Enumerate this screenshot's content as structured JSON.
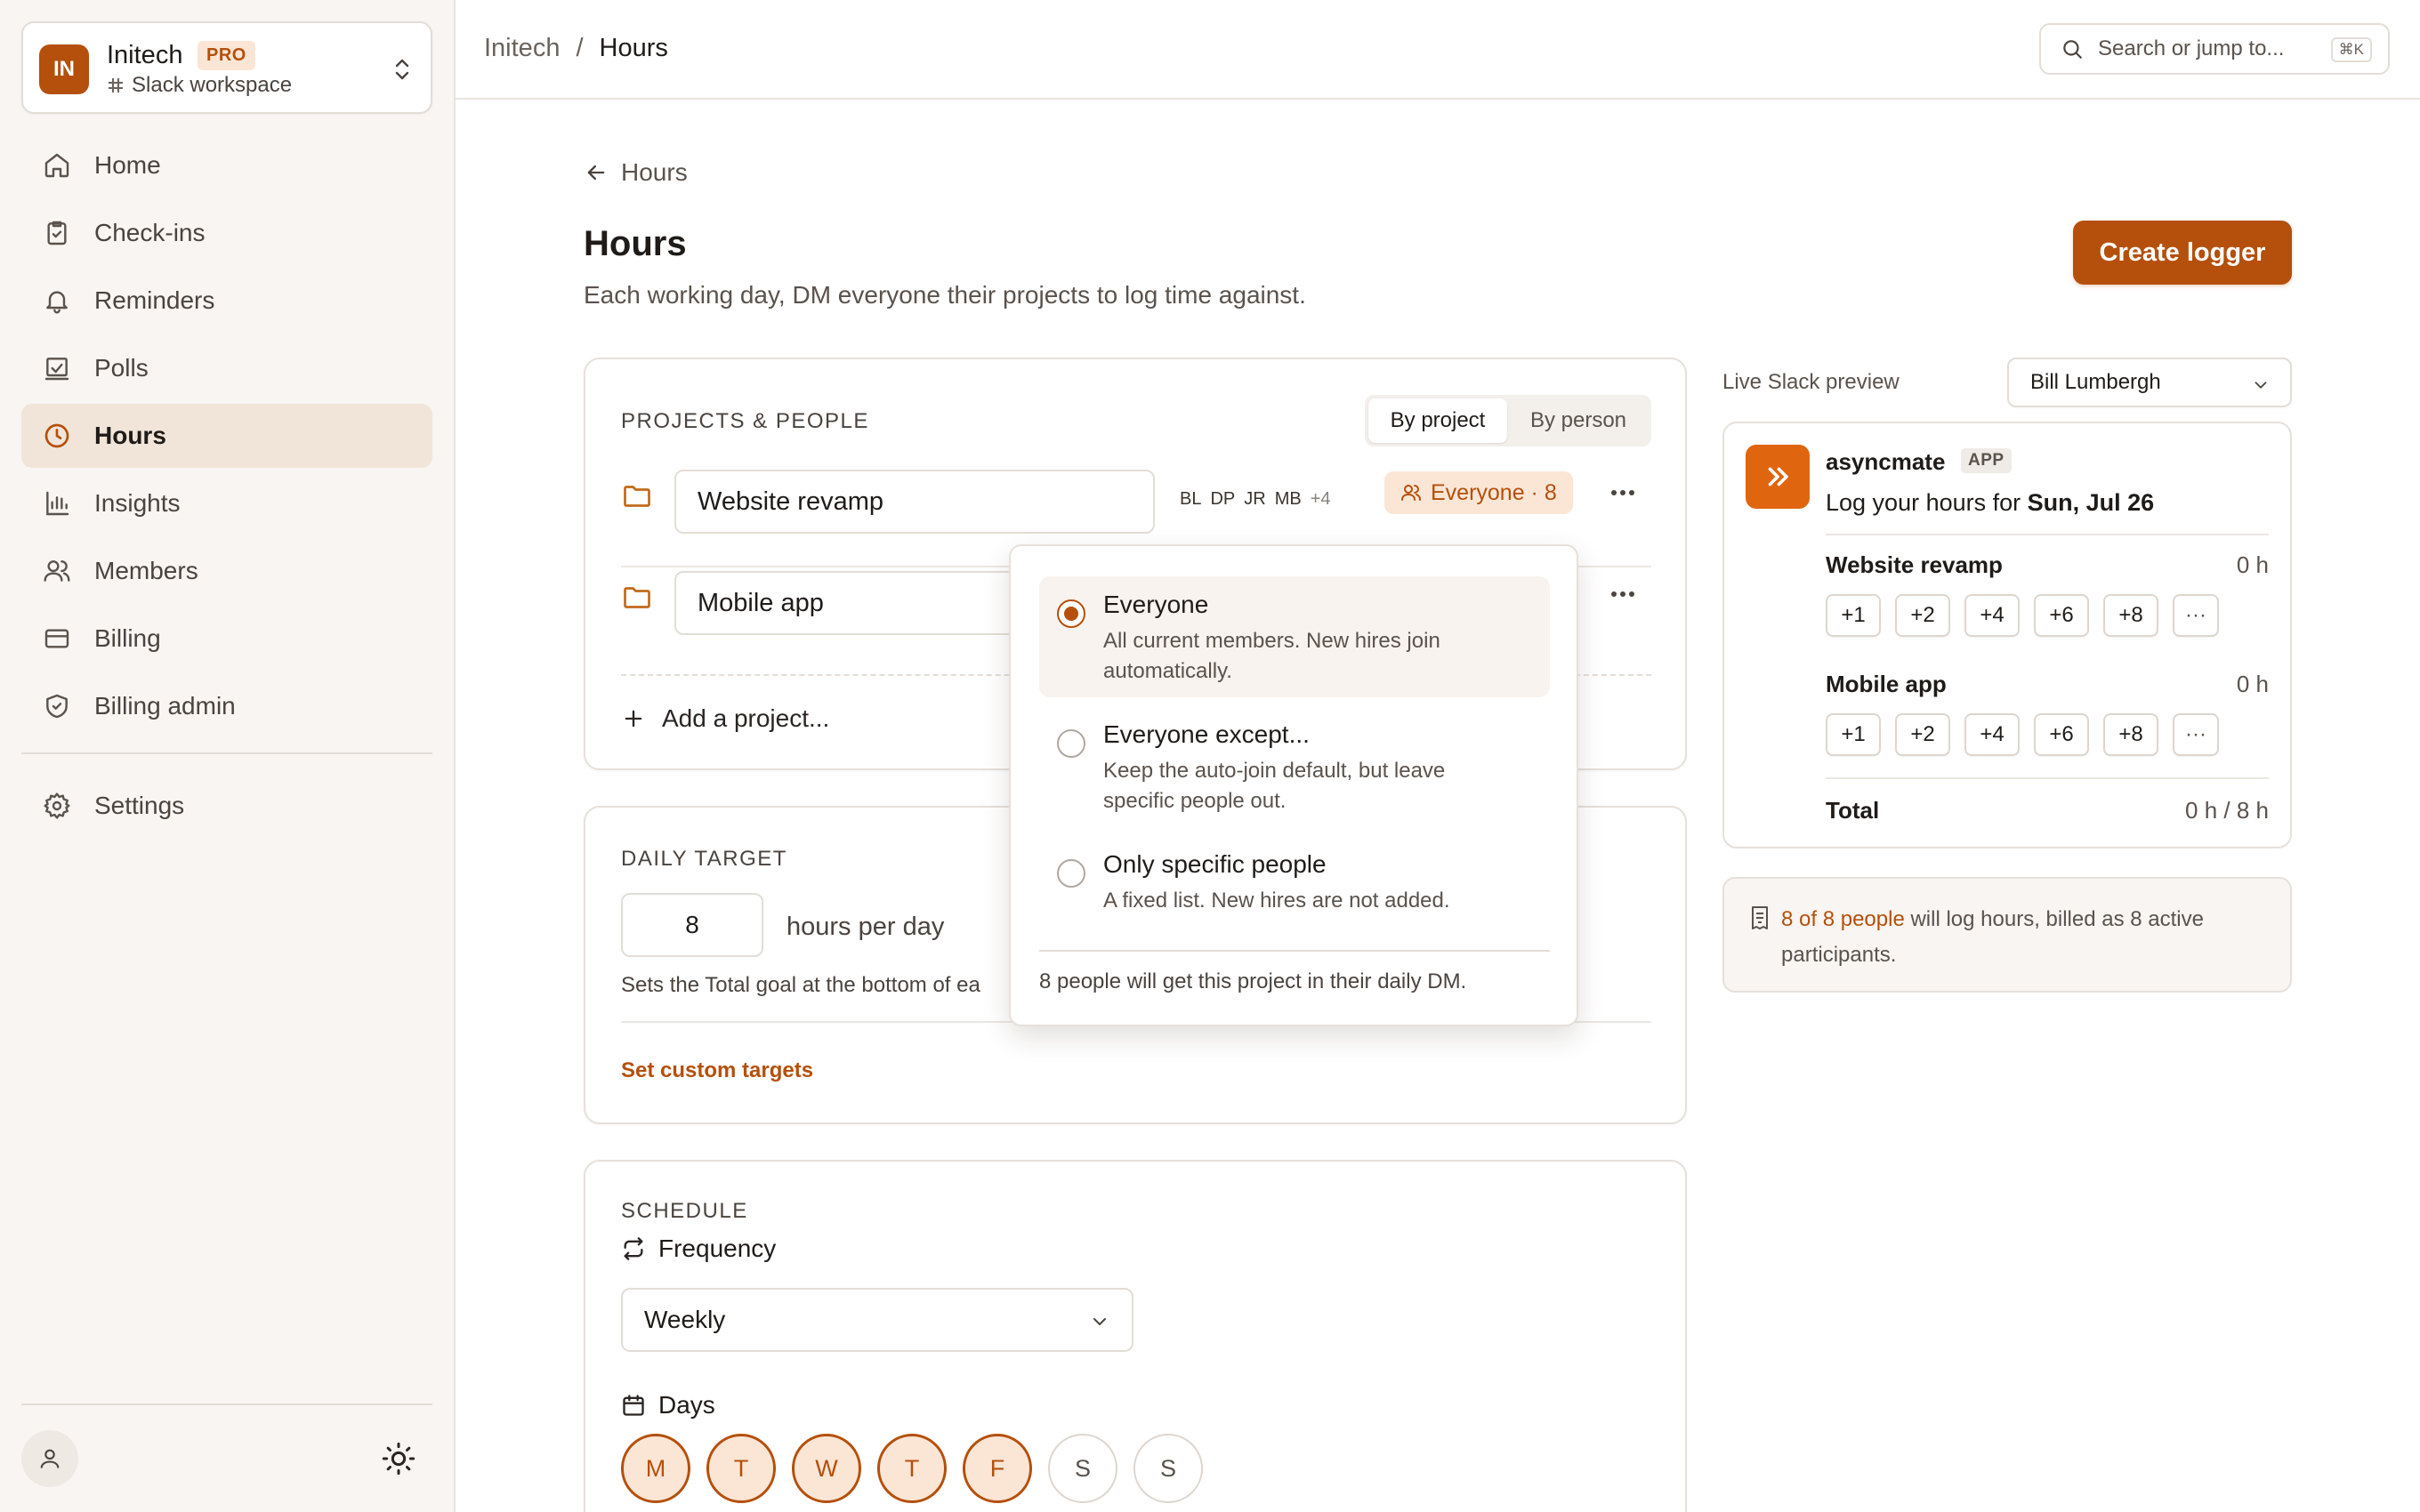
{
  "workspace": {
    "initials": "IN",
    "name": "Initech",
    "badge": "PRO",
    "subtitle": "Slack workspace"
  },
  "nav": [
    {
      "label": "Home",
      "icon": "home-icon"
    },
    {
      "label": "Check-ins",
      "icon": "clipboard-icon"
    },
    {
      "label": "Reminders",
      "icon": "bell-icon"
    },
    {
      "label": "Polls",
      "icon": "poll-icon"
    },
    {
      "label": "Hours",
      "icon": "clock-icon",
      "active": true
    },
    {
      "label": "Insights",
      "icon": "chart-icon"
    },
    {
      "label": "Members",
      "icon": "users-icon"
    },
    {
      "label": "Billing",
      "icon": "card-icon"
    },
    {
      "label": "Billing admin",
      "icon": "shield-icon"
    }
  ],
  "settings": {
    "label": "Settings"
  },
  "breadcrumb": {
    "root": "Initech",
    "sep": "/",
    "current": "Hours"
  },
  "search": {
    "placeholder": "Search or jump to...",
    "shortcut": "⌘K"
  },
  "page": {
    "back_label": "Hours",
    "title": "Hours",
    "subtitle": "Each working day, DM everyone their projects to log time against.",
    "create_button": "Create logger"
  },
  "projects_card": {
    "label": "PROJECTS & PEOPLE",
    "toggle": [
      "By project",
      "By person"
    ],
    "projects": [
      {
        "name": "Website revamp",
        "members": [
          "BL",
          "DP",
          "JR",
          "MB"
        ],
        "more": "+4",
        "audience": "Everyone · 8"
      },
      {
        "name": "Mobile app"
      }
    ],
    "add_label": "Add a project..."
  },
  "audience_menu": {
    "options": [
      {
        "title": "Everyone",
        "desc": "All current members. New hires join automatically.",
        "selected": true
      },
      {
        "title": "Everyone except...",
        "desc": "Keep the auto-join default, but leave specific people out.",
        "selected": false
      },
      {
        "title": "Only specific people",
        "desc": "A fixed list. New hires are not added.",
        "selected": false
      }
    ],
    "footer": "8 people will get this project in their daily DM."
  },
  "daily_target": {
    "label": "DAILY TARGET",
    "value": "8",
    "unit": "hours per day",
    "helper": "Sets the Total goal at the bottom of ea",
    "custom_link": "Set custom targets"
  },
  "schedule": {
    "label": "SCHEDULE",
    "frequency_label": "Frequency",
    "frequency_value": "Weekly",
    "days_label": "Days",
    "days": [
      {
        "l": "M",
        "on": true
      },
      {
        "l": "T",
        "on": true
      },
      {
        "l": "W",
        "on": true
      },
      {
        "l": "T",
        "on": true
      },
      {
        "l": "F",
        "on": true
      },
      {
        "l": "S",
        "on": false
      },
      {
        "l": "S",
        "on": false
      }
    ]
  },
  "preview": {
    "label": "Live Slack preview",
    "person": "Bill Lumbergh",
    "bot_name": "asyncmate",
    "bot_badge": "APP",
    "message_prefix": "Log your hours for",
    "message_date": "Sun, Jul 26",
    "projects": [
      {
        "name": "Website revamp",
        "hours": "0 h"
      },
      {
        "name": "Mobile app",
        "hours": "0 h"
      }
    ],
    "chips": [
      "+1",
      "+2",
      "+4",
      "+6",
      "+8",
      "···"
    ],
    "total_label": "Total",
    "total_value": "0 h / 8 h"
  },
  "billing_note": {
    "highlight": "8 of 8 people",
    "rest": " will log hours, billed as 8 active participants."
  },
  "colors": {
    "accent": "#b4500c",
    "accent_soft": "#fbe6d6",
    "sidebar_bg": "#f8f5f2",
    "bot": "#e0650f"
  }
}
